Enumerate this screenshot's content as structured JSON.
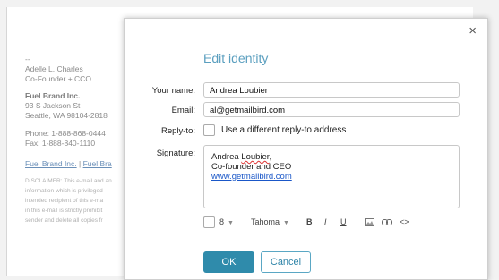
{
  "background_email": {
    "dashes": "--",
    "sender_name": "Adelle L. Charles",
    "sender_title": "Co-Founder + CCO",
    "company": "Fuel Brand Inc.",
    "address1": "93 S Jackson St",
    "address2": "Seattle, WA 98104-2818",
    "phone": "Phone: 1-888-868-0444",
    "fax": "Fax: 1-888-840-1110",
    "link1": "Fuel Brand Inc.",
    "link_sep": "|",
    "link2": "Fuel Bra",
    "disclaimer_lines": [
      "DISCLAIMER: This e-mail and an",
      "information which is privileged",
      "intended recipient of this e-ma",
      "in this e-mail is strictly prohibit",
      "sender and delete all copies fr"
    ]
  },
  "dialog": {
    "title": "Edit identity",
    "close_glyph": "×",
    "name_label": "Your name:",
    "name_value": "Andrea Loubier",
    "email_label": "Email:",
    "email_value": "al@getmailbird.com",
    "replyto_label": "Reply-to:",
    "replyto_checkbox_label": "Use a different reply-to address",
    "signature_label": "Signature:",
    "signature_name_pre": "Andrea ",
    "signature_name_misspelled": "Loubier",
    "signature_name_post": ",",
    "signature_title": "Co-founder and CEO",
    "signature_link": "www.getmailbird.com",
    "toolbar": {
      "font_size": "8",
      "font_family": "Tahoma",
      "bold": "B",
      "italic": "I",
      "underline": "U",
      "code": "<>"
    },
    "ok_label": "OK",
    "cancel_label": "Cancel"
  },
  "colors": {
    "accent": "#2f8bab",
    "title": "#5b9fbf",
    "link": "#1a57c8"
  }
}
